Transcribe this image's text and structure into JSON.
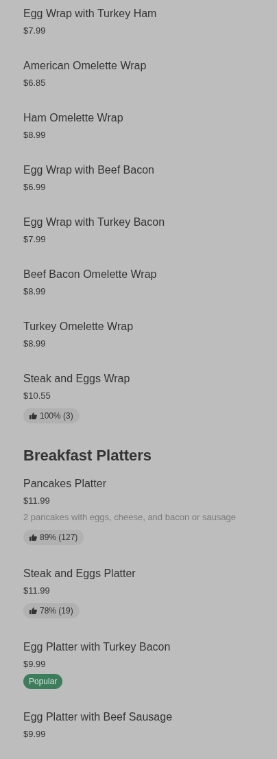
{
  "sections": [
    {
      "items": [
        {
          "name": "Egg Wrap with Turkey Ham",
          "price": "$7.99"
        },
        {
          "name": "American Omelette Wrap",
          "price": "$6.85"
        },
        {
          "name": "Ham Omelette Wrap",
          "price": "$8.99"
        },
        {
          "name": "Egg Wrap with Beef Bacon",
          "price": "$6.99"
        },
        {
          "name": "Egg Wrap with Turkey Bacon",
          "price": "$7.99"
        },
        {
          "name": "Beef Bacon Omelette Wrap",
          "price": "$8.99"
        },
        {
          "name": "Turkey Omelette Wrap",
          "price": "$8.99"
        },
        {
          "name": "Steak and Eggs Wrap",
          "price": "$10.55",
          "badge": {
            "kind": "rating",
            "text": "100% (3)"
          }
        }
      ]
    },
    {
      "title": "Breakfast Platters",
      "items": [
        {
          "name": "Pancakes Platter",
          "price": "$11.99",
          "description": "2 pancakes with eggs, cheese, and bacon or sausage",
          "badge": {
            "kind": "rating",
            "text": "89% (127)"
          }
        },
        {
          "name": "Steak and Eggs Platter",
          "price": "$11.99",
          "badge": {
            "kind": "rating",
            "text": "78% (19)"
          }
        },
        {
          "name": "Egg Platter with Turkey Bacon",
          "price": "$9.99",
          "badge": {
            "kind": "tag",
            "text": "Popular"
          }
        },
        {
          "name": "Egg Platter with Beef Sausage",
          "price": "$9.99"
        }
      ]
    }
  ]
}
